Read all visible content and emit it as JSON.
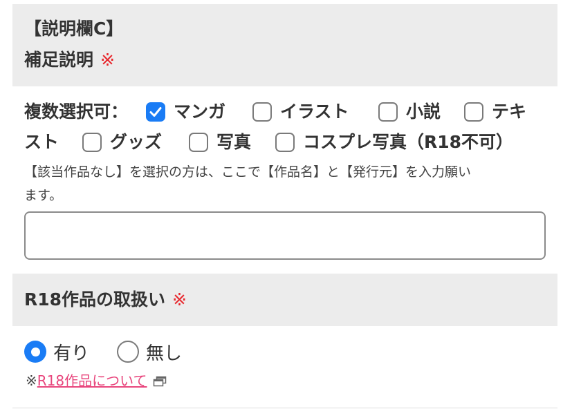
{
  "section_c": {
    "title": "【説明欄C】",
    "subtitle": "補足説明",
    "required_mark": "※"
  },
  "categories": {
    "label": "複数選択可：",
    "options": [
      {
        "label": "マンガ",
        "checked": true
      },
      {
        "label": "イラスト",
        "checked": false
      },
      {
        "label": "小説",
        "checked": false
      },
      {
        "label": "テキ",
        "checked": false
      },
      {
        "label": "グッズ",
        "checked": false
      },
      {
        "label": "写真",
        "checked": false
      },
      {
        "label": "コスプレ写真（R18不可）",
        "checked": false
      }
    ],
    "wrap_text": "スト"
  },
  "note": {
    "line1": "【該当作品なし】を選択の方は、ここで【作品名】と【発行元】を入力願い",
    "line2": "ます。"
  },
  "text_input": {
    "value": "",
    "placeholder": ""
  },
  "section_r18": {
    "title": "R18作品の取扱い",
    "required_mark": "※",
    "options": [
      {
        "label": "有り",
        "selected": true
      },
      {
        "label": "無し",
        "selected": false
      }
    ],
    "note_prefix": "※",
    "link_text": "R18作品について",
    "link_icon": "external-window-icon"
  },
  "colors": {
    "accent": "#1a7cf5",
    "required": "#e8262c",
    "link": "#e8457c",
    "section_bg": "#ececec"
  }
}
